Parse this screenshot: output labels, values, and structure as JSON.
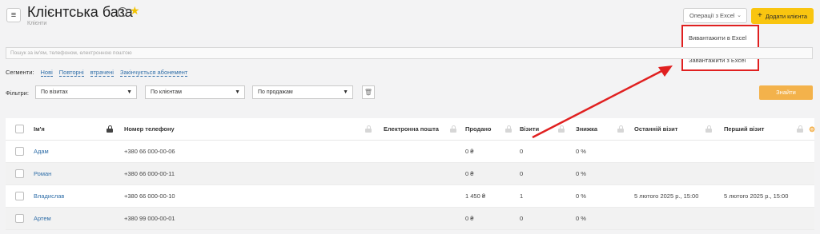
{
  "header": {
    "title": "Клієнтська база",
    "subtitle": "Клієнти",
    "ops_label": "Операції з Excel",
    "add_label": "Додати клієнта"
  },
  "dropdown": {
    "items": [
      "Вивантажити в Excel",
      "Завантажити з Excel"
    ]
  },
  "search": {
    "placeholder": "Пошук за ім'ям, телефоном, електронною поштою"
  },
  "segments": {
    "label": "Сегменти:",
    "items": [
      "Нові",
      "Повторні",
      "втрачені",
      "Закінчується абонемент"
    ]
  },
  "filters": {
    "label": "Фільтри:",
    "selects": [
      "По візитах",
      "По клієнтам",
      "По продажам"
    ],
    "find_label": "Знайти"
  },
  "table": {
    "columns": [
      "Ім'я",
      "Номер телефону",
      "Електронна пошта",
      "Продано",
      "Візити",
      "Знижка",
      "Останній візит",
      "Перший візит"
    ],
    "rows": [
      {
        "name": "Адам",
        "phone": "+380 66 000-00-06",
        "email": "",
        "sold": "0 ₴",
        "visits": "0",
        "discount": "0 %",
        "last": "",
        "first": ""
      },
      {
        "name": "Роман",
        "phone": "+380 66 000-00-11",
        "email": "",
        "sold": "0 ₴",
        "visits": "0",
        "discount": "0 %",
        "last": "",
        "first": ""
      },
      {
        "name": "Владислав",
        "phone": "+380 66 000-00-10",
        "email": "",
        "sold": "1 450 ₴",
        "visits": "1",
        "discount": "0 %",
        "last": "5 лютого 2025 р., 15:00",
        "first": "5 лютого 2025 р., 15:00"
      },
      {
        "name": "Артем",
        "phone": "+380 99 000-00-01",
        "email": "",
        "sold": "0 ₴",
        "visits": "0",
        "discount": "0 %",
        "last": "",
        "first": ""
      }
    ]
  },
  "colors": {
    "accent": "#f9c510",
    "find_button": "#f3b24b",
    "highlight": "#e02020",
    "link": "#2f6ea8"
  }
}
